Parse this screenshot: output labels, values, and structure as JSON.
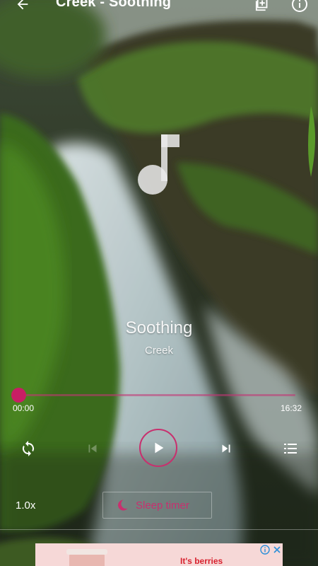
{
  "header": {
    "title": "Creek - Soothing",
    "back_icon": "arrow-left-icon",
    "playlist_add_icon": "playlist-add-icon",
    "info_icon": "info-icon"
  },
  "track": {
    "title": "Soothing",
    "artist": "Creek",
    "art_icon": "music-note-icon"
  },
  "progress": {
    "elapsed": "00:00",
    "duration": "16:32",
    "fraction": 0.0
  },
  "controls": {
    "repeat_icon": "repeat-icon",
    "previous_icon": "skip-previous-icon",
    "play_icon": "play-icon",
    "next_icon": "skip-next-icon",
    "queue_icon": "queue-list-icon"
  },
  "options": {
    "speed": "1.0x",
    "sleep_timer_label": "Sleep timer",
    "sleep_icon": "moon-icon"
  },
  "ad": {
    "text": "It's berries"
  },
  "colors": {
    "accent": "#c8306e",
    "progress_track": "#c23474"
  }
}
